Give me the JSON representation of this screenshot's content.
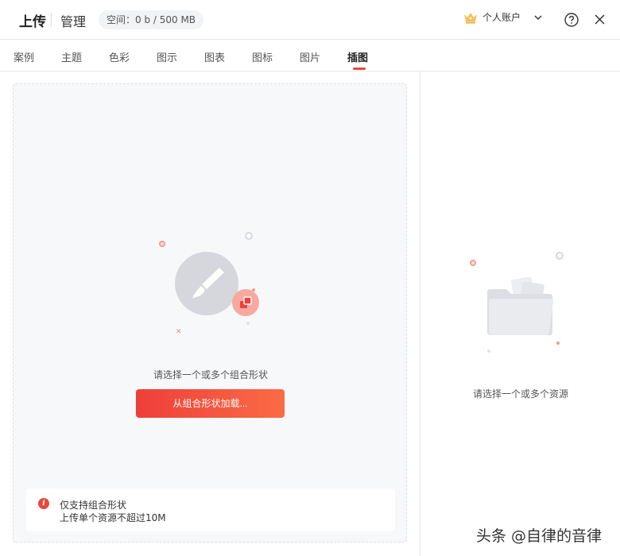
{
  "header": {
    "mode_upload": "上传",
    "mode_manage": "管理",
    "space_label": "空间：0 b / 500 MB",
    "account_label": "个人账户",
    "crown_icon": "crown-icon",
    "help_icon": "help-icon",
    "close_icon": "close-icon"
  },
  "tabs": [
    {
      "label": "案例",
      "active": false
    },
    {
      "label": "主题",
      "active": false
    },
    {
      "label": "色彩",
      "active": false
    },
    {
      "label": "图示",
      "active": false
    },
    {
      "label": "图表",
      "active": false
    },
    {
      "label": "图标",
      "active": false
    },
    {
      "label": "图片",
      "active": false
    },
    {
      "label": "插图",
      "active": true
    }
  ],
  "left_panel": {
    "select_hint": "请选择一个或多个组合形状",
    "load_button": "从组合形状加载...",
    "note_line1": "仅支持组合形状",
    "note_line2": "上传单个资源不超过10M",
    "illustration_icon": "brush-icon"
  },
  "right_panel": {
    "resource_hint": "请选择一个或多个资源",
    "illustration_icon": "folder-icon"
  },
  "watermark": "头条 @自律的音律",
  "colors": {
    "accent": "#e8483b",
    "button_gradient_start": "#ee3f3a",
    "button_gradient_end": "#fb6b45"
  }
}
